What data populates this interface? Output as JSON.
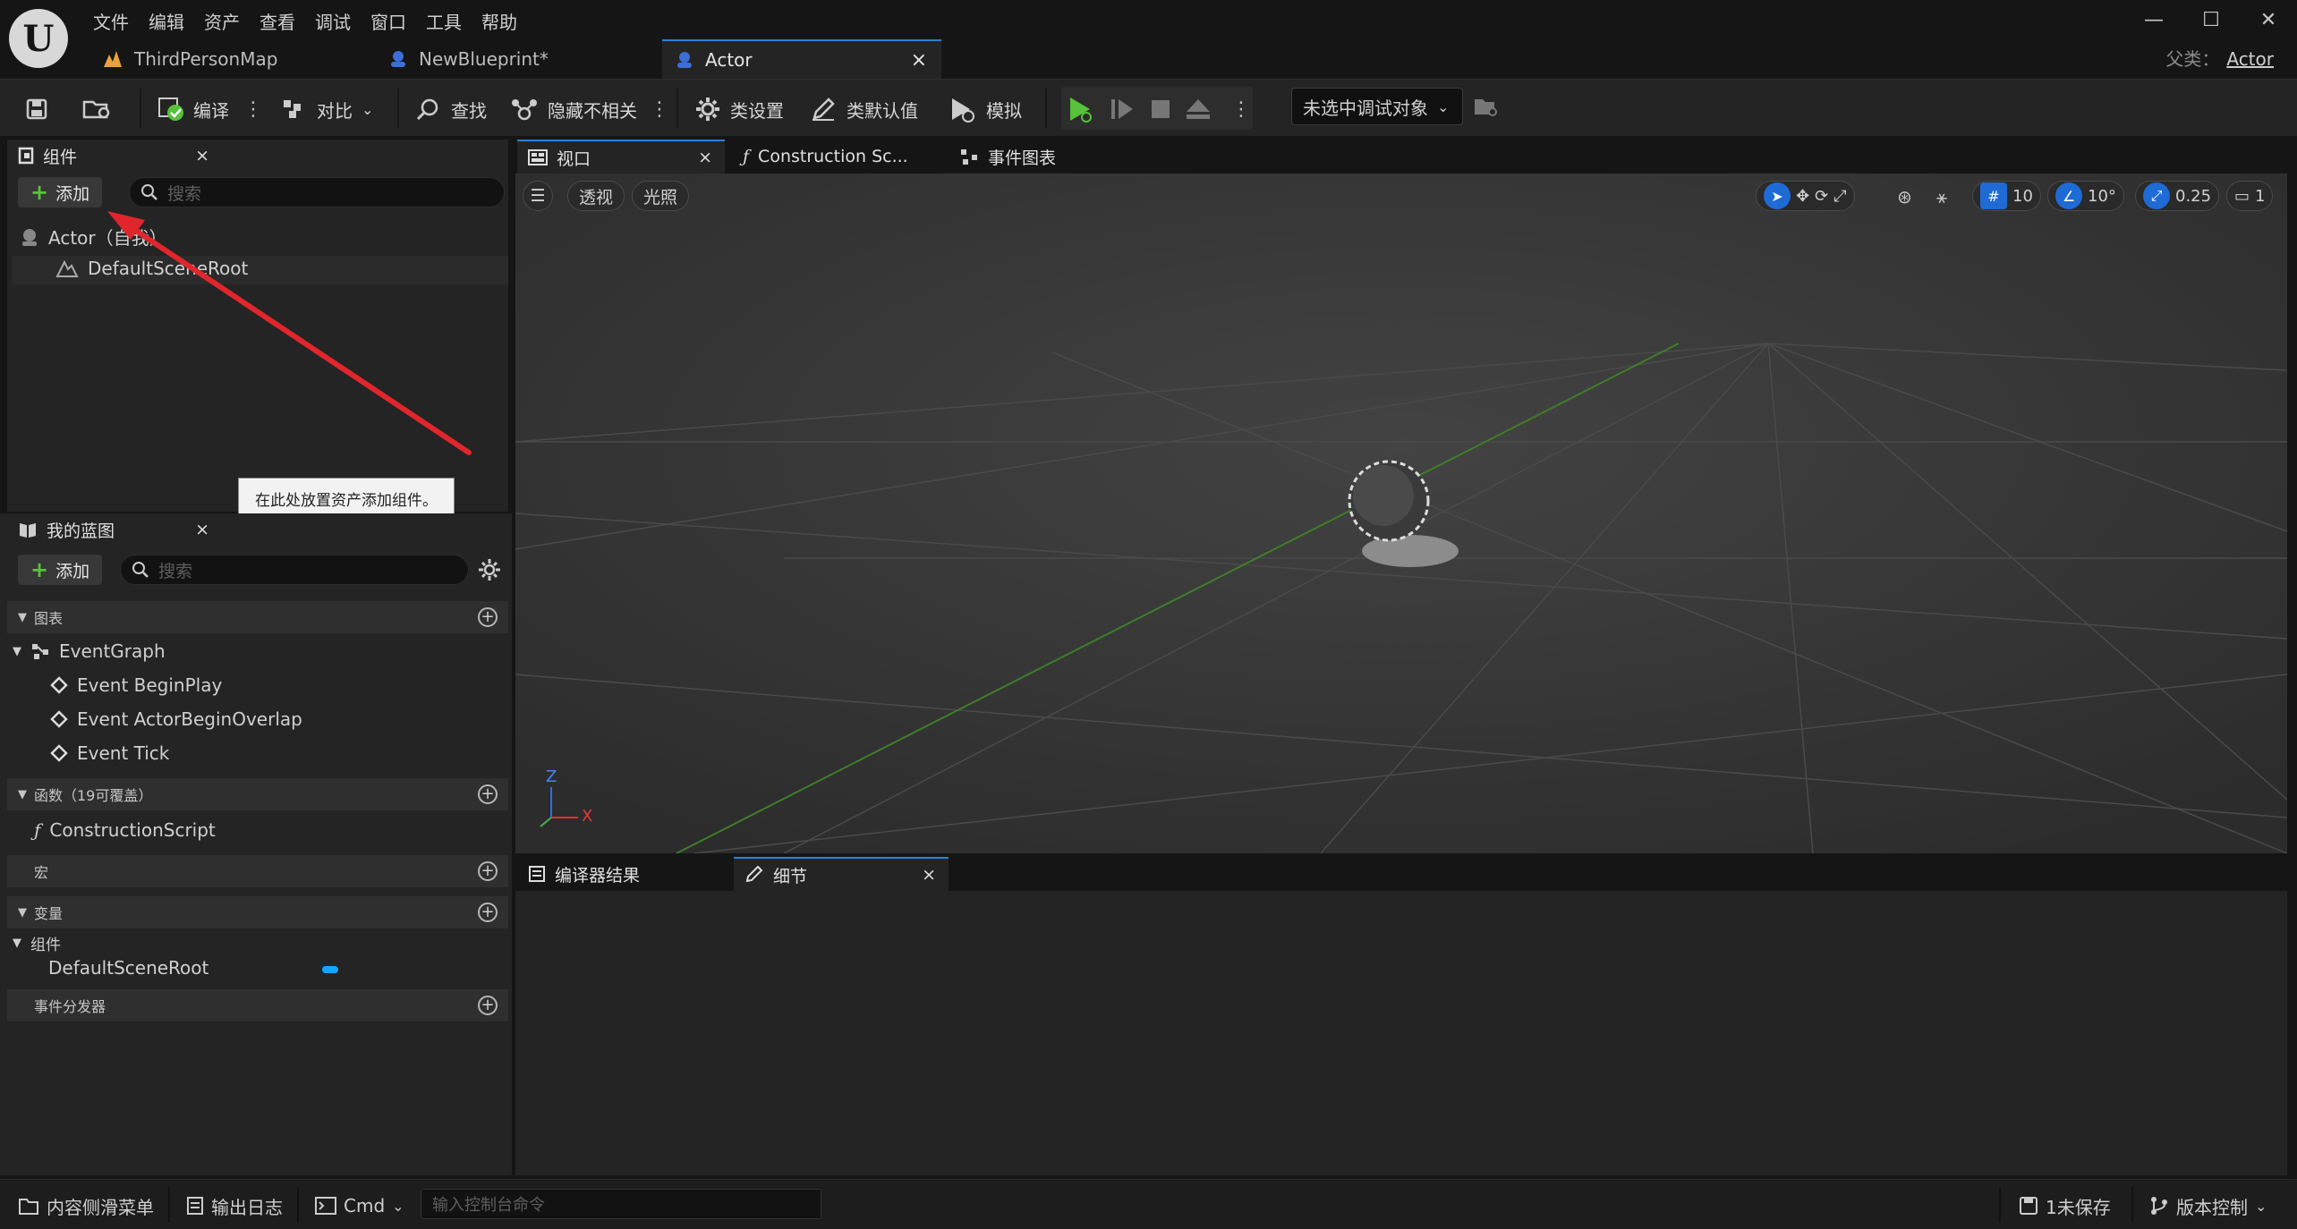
{
  "menu": [
    "文件",
    "编辑",
    "资产",
    "查看",
    "调试",
    "窗口",
    "工具",
    "帮助"
  ],
  "window_controls": {
    "minimize": "—",
    "maximize": "☐",
    "close": "✕"
  },
  "doc_tabs": [
    {
      "label": "ThirdPersonMap"
    },
    {
      "label": "NewBlueprint*"
    },
    {
      "label": "Actor",
      "close": "×"
    }
  ],
  "parent_class": {
    "label": "父类：",
    "value": "Actor"
  },
  "toolbar": {
    "compile": "编译",
    "diff": "对比",
    "find": "查找",
    "hide_unrelated": "隐藏不相关",
    "class_settings": "类设置",
    "class_defaults": "类默认值",
    "simulate": "模拟",
    "debug_target": "未选中调试对象"
  },
  "components_panel": {
    "title": "组件",
    "close": "×",
    "add": "添加",
    "search_placeholder": "搜索",
    "root": "Actor（自我）",
    "child": "DefaultSceneRoot"
  },
  "tooltip": "在此处放置资产添加组件。",
  "my_blueprint": {
    "title": "我的蓝图",
    "close": "×",
    "add": "添加",
    "search_placeholder": "搜索",
    "graphs_header": "图表",
    "event_graph": "EventGraph",
    "events": [
      "Event BeginPlay",
      "Event ActorBeginOverlap",
      "Event Tick"
    ],
    "functions_header": "函数（19可覆盖）",
    "construction_script": "ConstructionScript",
    "macros_header": "宏",
    "variables_header": "变量",
    "components_group": "组件",
    "variable_default_scene_root": "DefaultSceneRoot",
    "dispatchers_header": "事件分发器"
  },
  "editor_tabs": [
    {
      "label": "视口",
      "close": "×"
    },
    {
      "label": "Construction Sc..."
    },
    {
      "label": "事件图表"
    }
  ],
  "viewport": {
    "perspective": "透视",
    "lighting": "光照",
    "grid_snap": "10",
    "rotation_snap": "10°",
    "scale_snap": "0.25",
    "camera_speed": "1",
    "axis_z": "Z",
    "axis_x": "X"
  },
  "bottom_tabs": [
    {
      "label": "编译器结果"
    },
    {
      "label": "细节",
      "close": "×"
    }
  ],
  "statusbar": {
    "content_drawer": "内容侧滑菜单",
    "output_log": "输出日志",
    "cmd": "Cmd",
    "console_placeholder": "输入控制台命令",
    "unsaved": "1未保存",
    "source_control": "版本控制"
  },
  "colors": {
    "accent_blue": "#2d7fd8",
    "play_green": "#57c23a",
    "annotation_red": "#e0262c",
    "var_color": "#16a6ff"
  }
}
